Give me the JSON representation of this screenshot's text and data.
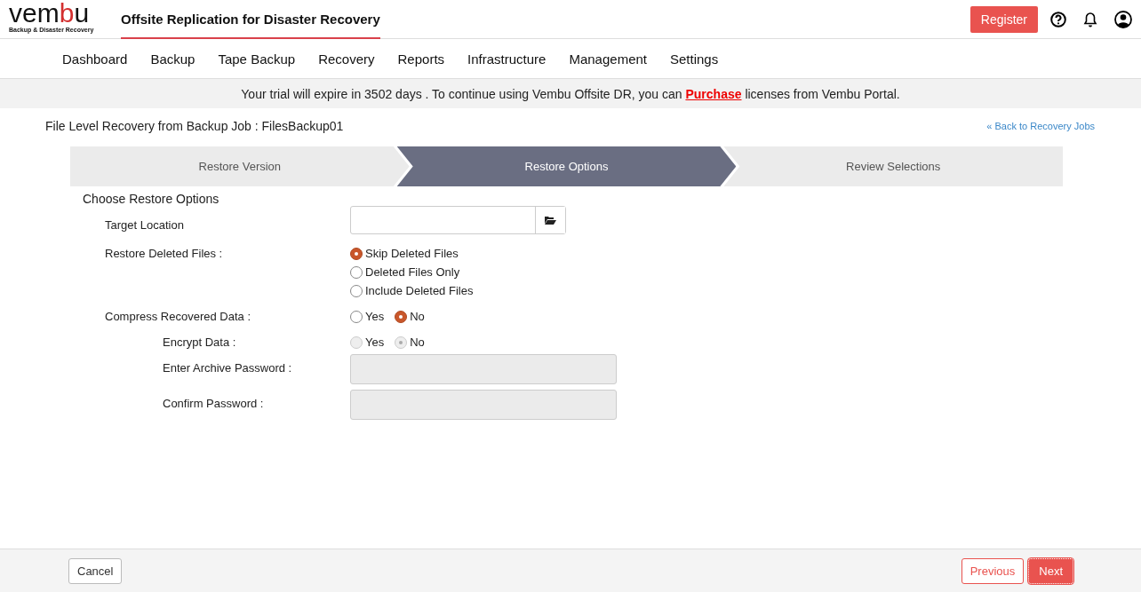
{
  "logo": {
    "parts": [
      {
        "text": "vem",
        "accent": false
      },
      {
        "text": "b",
        "accent": true
      },
      {
        "text": "u",
        "accent": false
      }
    ],
    "tagline": "Backup & Disaster Recovery"
  },
  "app_title": "Offsite Replication for Disaster Recovery",
  "register_button": "Register",
  "nav": [
    {
      "label": "Dashboard",
      "selected": false
    },
    {
      "label": "Backup",
      "selected": false
    },
    {
      "label": "Tape Backup",
      "selected": false
    },
    {
      "label": "Recovery",
      "selected": false
    },
    {
      "label": "Reports",
      "selected": false
    },
    {
      "label": "Infrastructure",
      "selected": false
    },
    {
      "label": "Management",
      "selected": false
    },
    {
      "label": "Settings",
      "selected": false
    }
  ],
  "banner": {
    "before": "Your trial will expire in 3502 days . To continue using Vembu Offsite DR, you can",
    "link": "Purchase",
    "after": "licenses from Vembu Portal."
  },
  "page_title": "File Level Recovery from Backup Job : FilesBackup01",
  "back_link": "« Back to Recovery Jobs",
  "steps": [
    {
      "label": "Restore Version",
      "selected": false
    },
    {
      "label": "Restore Options",
      "selected": true
    },
    {
      "label": "Review Selections",
      "selected": false
    }
  ],
  "section_title": "Choose Restore Options",
  "rows": [
    {
      "kind": "path",
      "label": "Target Location",
      "value": ""
    },
    {
      "kind": "radio_list",
      "label": "Restore Deleted Files :",
      "options": [
        {
          "label": "Skip Deleted Files",
          "selected": true
        },
        {
          "label": "Deleted Files Only",
          "selected": false
        },
        {
          "label": "Include Deleted Files",
          "selected": false
        }
      ]
    },
    {
      "kind": "radio_inline",
      "label": "Compress Recovered Data :",
      "options": [
        {
          "label": "Yes",
          "selected": false
        },
        {
          "label": "No",
          "selected": true
        }
      ],
      "children": [
        {
          "kind": "radio_inline",
          "label": "Encrypt Data :",
          "options": [
            {
              "label": "Yes",
              "selected": false
            },
            {
              "label": "No",
              "selected": true
            }
          ],
          "disabled": true
        },
        {
          "kind": "password",
          "label": "Enter Archive Password :",
          "disabled": true
        },
        {
          "kind": "password",
          "label": "Confirm Password :",
          "disabled": true
        }
      ]
    }
  ],
  "footer": {
    "cancel": "Cancel",
    "previous": "Previous",
    "next": "Next"
  }
}
